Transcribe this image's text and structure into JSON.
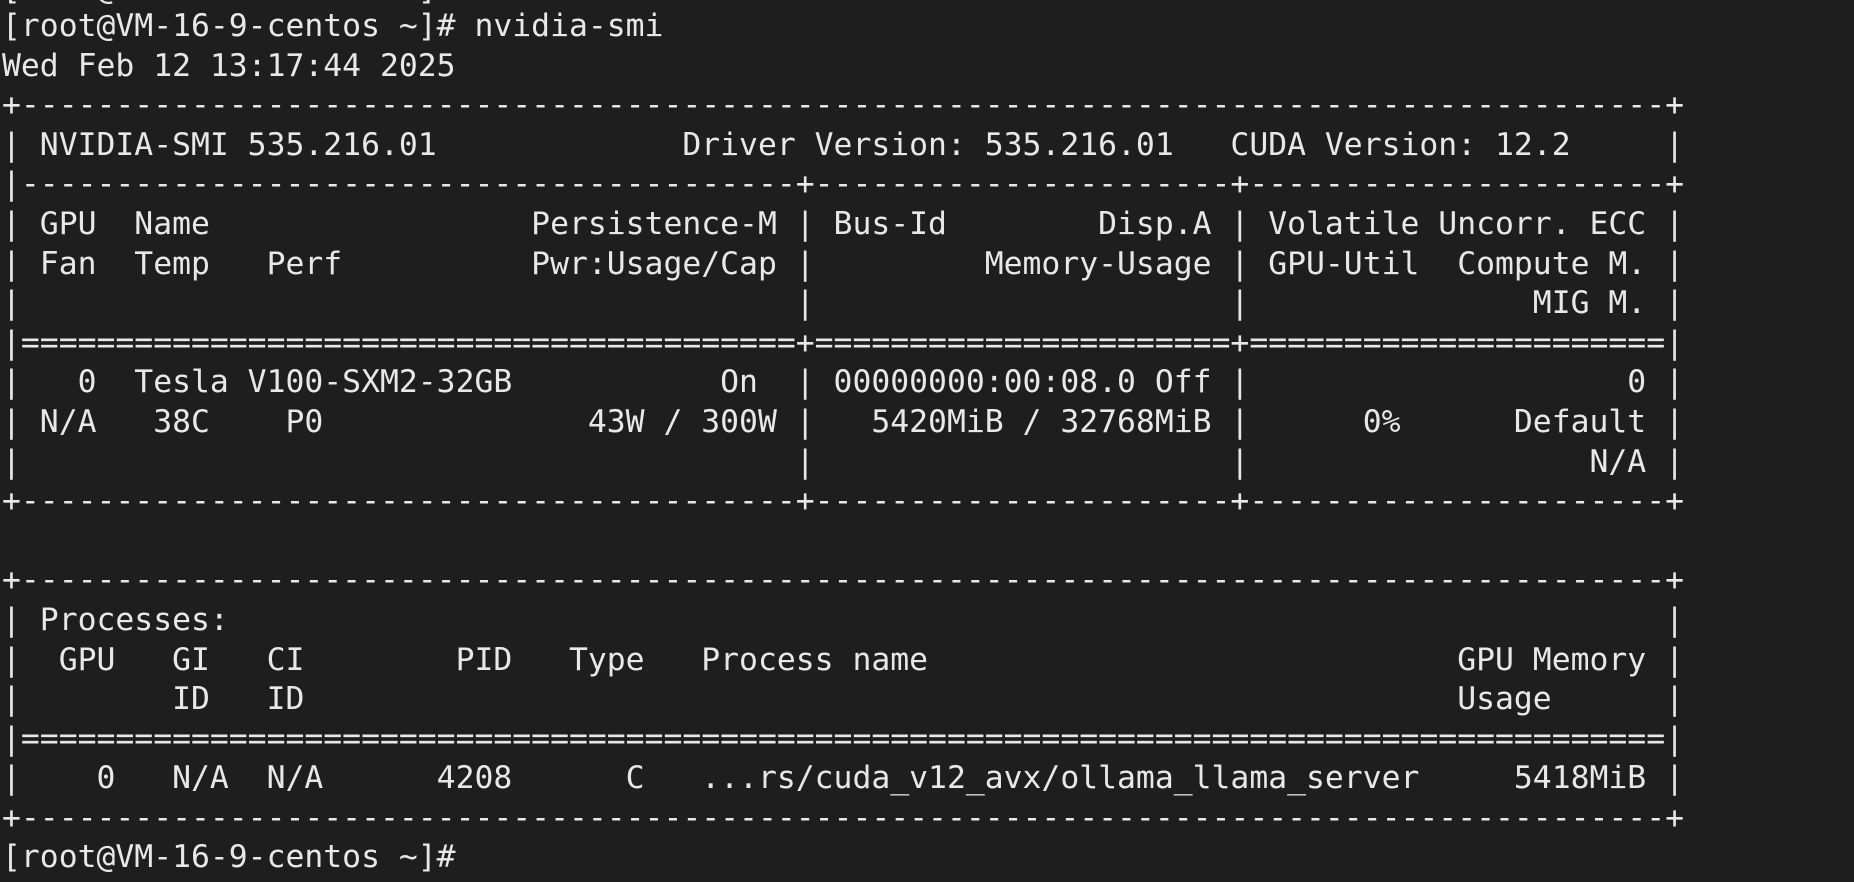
{
  "terminal": {
    "clipped_line": "[root@VM-16-9-centos ~]#",
    "lines": [
      "[root@VM-16-9-centos ~]# nvidia-smi",
      "Wed Feb 12 13:17:44 2025",
      "+---------------------------------------------------------------------------------------+",
      "| NVIDIA-SMI 535.216.01             Driver Version: 535.216.01   CUDA Version: 12.2     |",
      "|-----------------------------------------+----------------------+----------------------+",
      "| GPU  Name                 Persistence-M | Bus-Id        Disp.A | Volatile Uncorr. ECC |",
      "| Fan  Temp   Perf          Pwr:Usage/Cap |         Memory-Usage | GPU-Util  Compute M. |",
      "|                                         |                      |               MIG M. |",
      "|=========================================+======================+======================|",
      "|   0  Tesla V100-SXM2-32GB           On  | 00000000:00:08.0 Off |                    0 |",
      "| N/A   38C    P0              43W / 300W |   5420MiB / 32768MiB |      0%      Default |",
      "|                                         |                      |                  N/A |",
      "+-----------------------------------------+----------------------+----------------------+",
      "",
      "+---------------------------------------------------------------------------------------+",
      "| Processes:                                                                            |",
      "|  GPU   GI   CI        PID   Type   Process name                            GPU Memory |",
      "|        ID   ID                                                             Usage      |",
      "|=======================================================================================|",
      "|    0   N/A  N/A      4208      C   ...rs/cuda_v12_avx/ollama_llama_server     5418MiB |",
      "+---------------------------------------------------------------------------------------+",
      "[root@VM-16-9-centos ~]#"
    ]
  }
}
